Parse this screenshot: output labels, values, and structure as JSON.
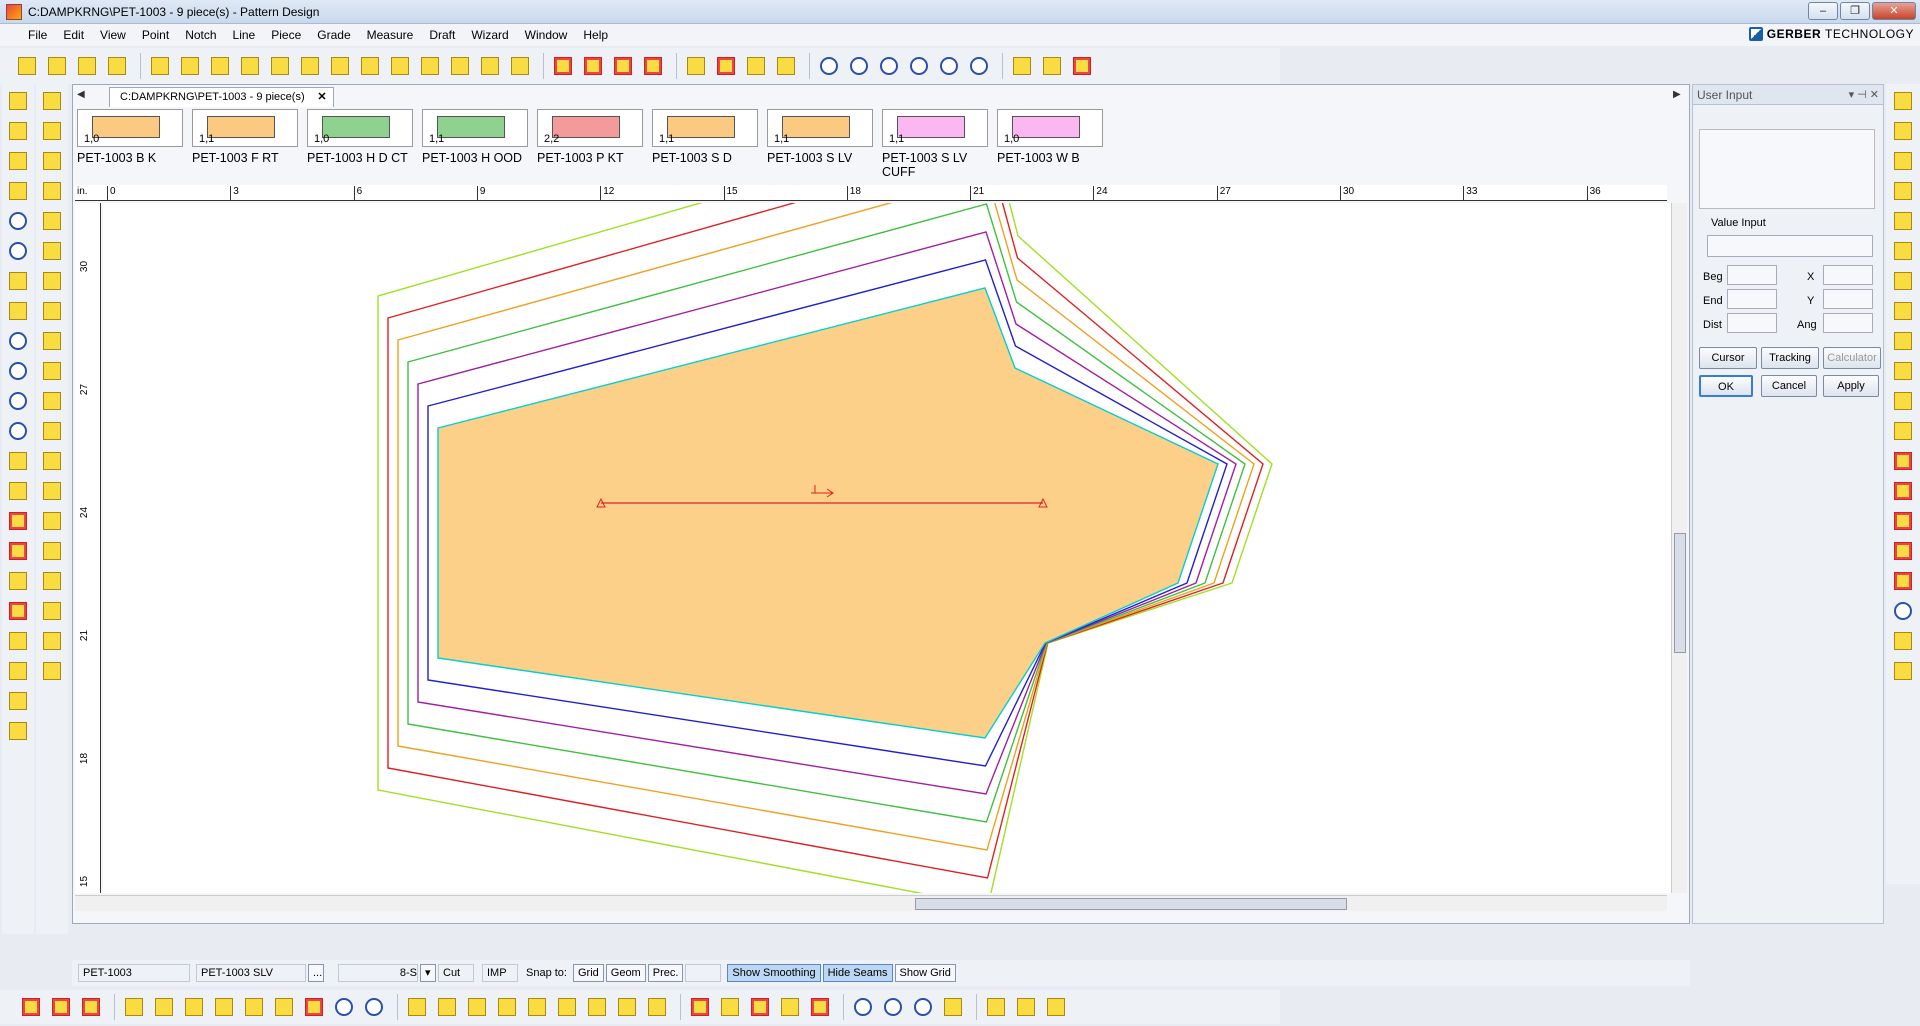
{
  "window": {
    "title": "C:DAMPKRNG\\PET-1003  -  9 piece(s) - Pattern Design"
  },
  "menu": [
    "File",
    "Edit",
    "View",
    "Point",
    "Notch",
    "Line",
    "Piece",
    "Grade",
    "Measure",
    "Draft",
    "Wizard",
    "Window",
    "Help"
  ],
  "brand": {
    "name": "GERBER",
    "suffix": "TECHNOLOGY"
  },
  "document_tab": "C:DAMPKRNG\\PET-1003  -  9 piece(s)",
  "pieces": [
    {
      "size": "1,0",
      "name": "PET-1003 B K",
      "fill": "#fbc981"
    },
    {
      "size": "1,1",
      "name": "PET-1003 F RT",
      "fill": "#fbc981"
    },
    {
      "size": "1,0",
      "name": "PET-1003 H D CT",
      "fill": "#8fd18f"
    },
    {
      "size": "1,1",
      "name": "PET-1003 H OOD",
      "fill": "#8fd18f"
    },
    {
      "size": "2,2",
      "name": "PET-1003 P KT",
      "fill": "#f59a9a"
    },
    {
      "size": "1,1",
      "name": "PET-1003 S D",
      "fill": "#fbc981"
    },
    {
      "size": "1,1",
      "name": "PET-1003 S LV",
      "fill": "#fbc981"
    },
    {
      "size": "1,1",
      "name": "PET-1003 S LV CUFF",
      "fill": "#fbb7f2"
    },
    {
      "size": "1,0",
      "name": "PET-1003 W B",
      "fill": "#fbb7f2"
    }
  ],
  "ruler": {
    "unit": "in.",
    "h_ticks": [
      "0",
      "3",
      "6",
      "9",
      "12",
      "15",
      "18",
      "21",
      "24",
      "27",
      "30",
      "33",
      "36"
    ],
    "v_ticks": [
      "30",
      "27",
      "24",
      "21",
      "18",
      "15"
    ]
  },
  "user_input": {
    "title": "User Input",
    "value_input_label": "Value Input",
    "beg": "Beg",
    "end": "End",
    "dist": "Dist",
    "x": "X",
    "y": "Y",
    "ang": "Ang",
    "cursor": "Cursor",
    "tracking": "Tracking",
    "calculator": "Calculator",
    "ok": "OK",
    "cancel": "Cancel",
    "apply": "Apply"
  },
  "status": {
    "style": "PET-1003",
    "piece": "PET-1003 SLV",
    "size": "8-S",
    "cut": "Cut",
    "units": "IMP",
    "snap_label": "Snap to:",
    "grid": "Grid",
    "geom": "Geom",
    "prec": "Prec.",
    "show_smoothing": "Show Smoothing",
    "hide_seams": "Hide Seams",
    "show_grid": "Show Grid"
  },
  "colors": {
    "piece_fill": "#fdd08a",
    "grade_rules": [
      "#00d0d0",
      "#2020d0",
      "#a020a0",
      "#40c040",
      "#f0a020",
      "#e02020",
      "#a0e020",
      "#ff40c0"
    ],
    "grain_line": "#e02020"
  }
}
